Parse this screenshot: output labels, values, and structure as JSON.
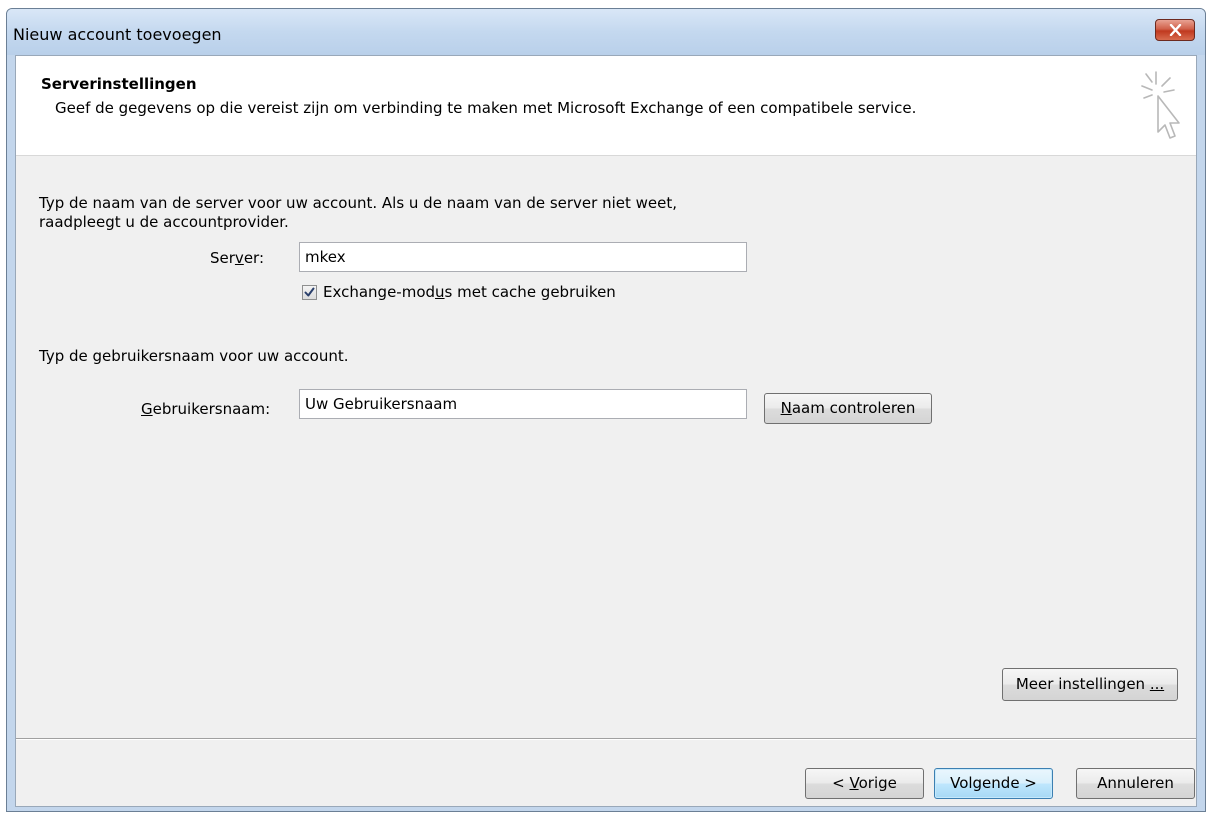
{
  "window": {
    "title": "Nieuw account toevoegen"
  },
  "header": {
    "title": "Serverinstellingen",
    "description": "Geef de gegevens op die vereist zijn om verbinding te maken met Microsoft Exchange of een compatibele service.",
    "icon": "sparkle-cursor-icon"
  },
  "server_section": {
    "instruction_line1": "Typ de naam van de server voor uw account. Als u de naam van de server niet weet,",
    "instruction_line2": "raadpleegt u de accountprovider.",
    "server_label_pre": "Ser",
    "server_label_mnemonic": "v",
    "server_label_post": "er:",
    "server_value": "mkex",
    "cache_checkbox_checked": true,
    "cache_label_pre": "Exchange-mod",
    "cache_label_mnemonic": "u",
    "cache_label_post": "s met cache gebruiken"
  },
  "user_section": {
    "instruction": "Typ de gebruikersnaam voor uw account.",
    "username_label_mnemonic": "G",
    "username_label_post": "ebruikersnaam:",
    "username_value": "Uw Gebruikersnaam",
    "check_name_mnemonic": "N",
    "check_name_post": "aam controleren"
  },
  "more_settings": {
    "label_pre": "Meer instellingen ",
    "label_mnemonic": "...",
    "label_post": ""
  },
  "footer": {
    "back_pre": "< ",
    "back_mnemonic": "V",
    "back_post": "orige",
    "next_label": "Volgende >",
    "cancel_label": "Annuleren"
  },
  "colors": {
    "title_bar": "#c4d8ef",
    "close_button": "#c0391f",
    "dialog_background": "#f0f0f0",
    "default_button_border": "#3c7fb1"
  }
}
